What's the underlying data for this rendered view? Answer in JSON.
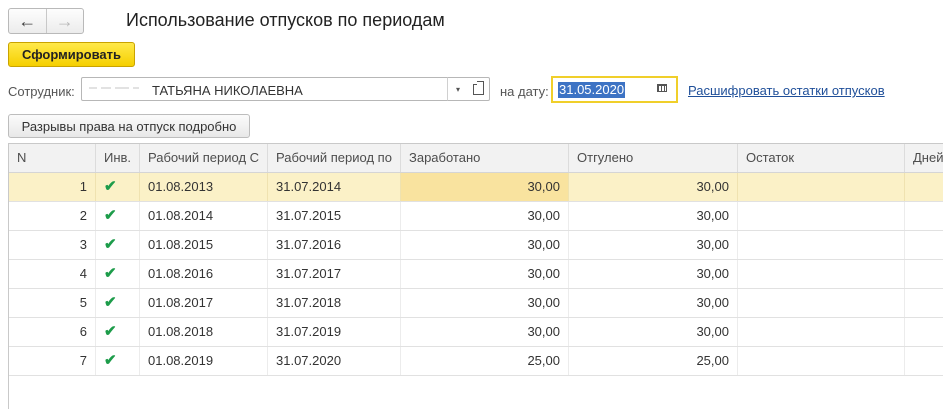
{
  "nav": {
    "back_glyph": "←",
    "forward_glyph": "→"
  },
  "title": "Использование отпусков по периодам",
  "form_button": "Сформировать",
  "employee": {
    "label": "Сотрудник:",
    "value": "ТАТЬЯНА НИКОЛАЕВНА",
    "dropdown_glyph": "▾"
  },
  "date": {
    "label": "на дату:",
    "value": "31.05.2020"
  },
  "decode_link": "Расшифровать остатки отпусков",
  "gaps_button": "Разрывы права на отпуск подробно",
  "colors": {
    "accent_yellow": "#f5cf00",
    "selected_row": "#fbf1c7",
    "check_green": "#1d9c4a",
    "link": "#1f4f99"
  },
  "table": {
    "headers": [
      "N",
      "Инв.",
      "Рабочий период С",
      "Рабочий период по",
      "Заработано",
      "Отгулено",
      "Остаток",
      "Дней"
    ],
    "rows": [
      {
        "n": "1",
        "inv": "✔",
        "from": "01.08.2013",
        "to": "31.07.2014",
        "earned": "30,00",
        "used": "30,00",
        "rest": "",
        "days": ""
      },
      {
        "n": "2",
        "inv": "✔",
        "from": "01.08.2014",
        "to": "31.07.2015",
        "earned": "30,00",
        "used": "30,00",
        "rest": "",
        "days": ""
      },
      {
        "n": "3",
        "inv": "✔",
        "from": "01.08.2015",
        "to": "31.07.2016",
        "earned": "30,00",
        "used": "30,00",
        "rest": "",
        "days": ""
      },
      {
        "n": "4",
        "inv": "✔",
        "from": "01.08.2016",
        "to": "31.07.2017",
        "earned": "30,00",
        "used": "30,00",
        "rest": "",
        "days": ""
      },
      {
        "n": "5",
        "inv": "✔",
        "from": "01.08.2017",
        "to": "31.07.2018",
        "earned": "30,00",
        "used": "30,00",
        "rest": "",
        "days": ""
      },
      {
        "n": "6",
        "inv": "✔",
        "from": "01.08.2018",
        "to": "31.07.2019",
        "earned": "30,00",
        "used": "30,00",
        "rest": "",
        "days": ""
      },
      {
        "n": "7",
        "inv": "✔",
        "from": "01.08.2019",
        "to": "31.07.2020",
        "earned": "25,00",
        "used": "25,00",
        "rest": "",
        "days": ""
      }
    ]
  }
}
